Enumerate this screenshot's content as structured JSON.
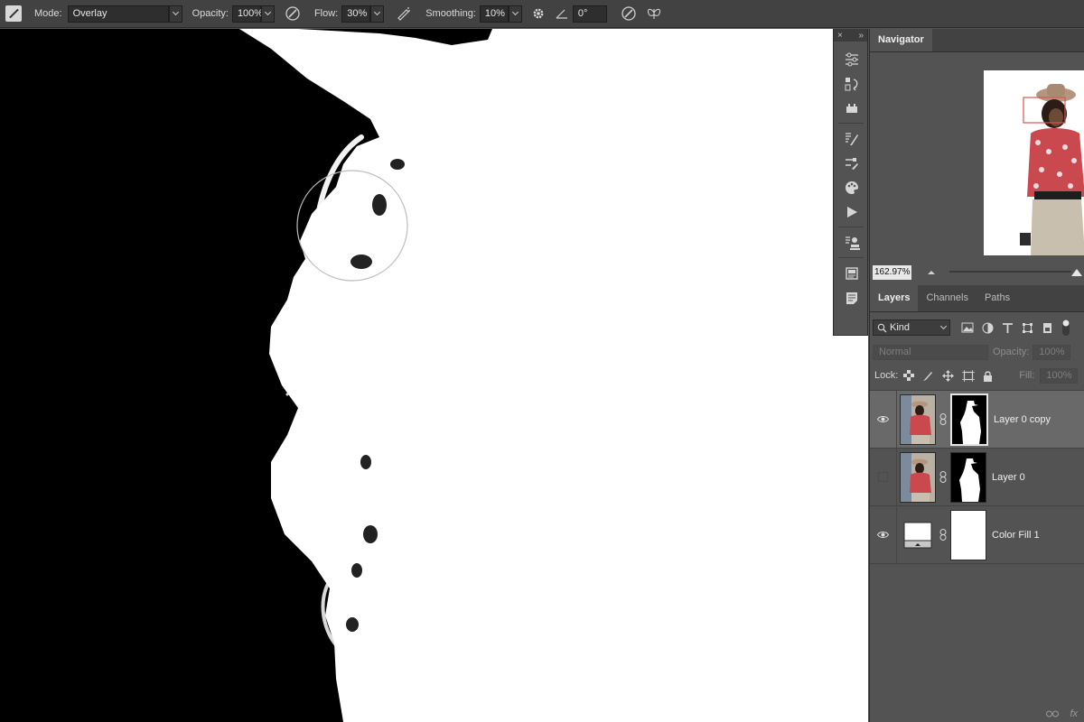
{
  "options_bar": {
    "tool_icon": "brush-tool-icon",
    "mode_label": "Mode:",
    "mode_value": "Overlay",
    "opacity_label": "Opacity:",
    "opacity_value": "100%",
    "flow_label": "Flow:",
    "flow_value": "30%",
    "smoothing_label": "Smoothing:",
    "smoothing_value": "10%",
    "angle_value": "0°"
  },
  "strip": {
    "close": "×",
    "collapse": "»"
  },
  "navigator": {
    "tab": "Navigator",
    "zoom": "162.97%"
  },
  "layers_panel": {
    "tabs": [
      "Layers",
      "Channels",
      "Paths"
    ],
    "filter_kind": "Kind",
    "blend_mode": "Normal",
    "opacity_label": "Opacity:",
    "opacity_value": "100%",
    "lock_label": "Lock:",
    "fill_label": "Fill:",
    "fill_value": "100%",
    "layers": [
      {
        "name": "Layer 0 copy",
        "visible": true,
        "selected": true
      },
      {
        "name": "Layer 0",
        "visible": false,
        "selected": false
      },
      {
        "name": "Color Fill 1",
        "visible": true,
        "selected": false
      }
    ],
    "footer_fx": "fx"
  },
  "colors": {
    "accent_nav_box": "#d9534f",
    "panel_bg": "#535353",
    "bar_bg": "#424242"
  }
}
